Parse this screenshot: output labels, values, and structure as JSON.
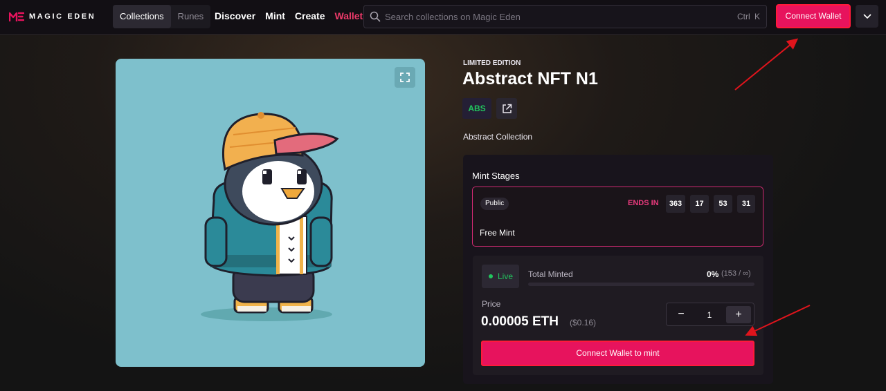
{
  "header": {
    "logo_text": "MAGIC EDEN",
    "segments": [
      "Collections",
      "Runes"
    ],
    "nav": [
      "Discover",
      "Mint",
      "Create",
      "Wallet"
    ],
    "search_placeholder": "Search collections on Magic Eden",
    "search_shortcut": "Ctrl K",
    "connect_label": "Connect Wallet",
    "colors": {
      "accent": "#e7135d",
      "wallet_link": "#f03b6b"
    }
  },
  "nft": {
    "edition": "LIMITED EDITION",
    "title": "Abstract NFT N1",
    "chain_chip": "ABS",
    "collection": "Abstract Collection",
    "art_background": "#7ec0cc"
  },
  "mint": {
    "stages_title": "Mint Stages",
    "stage_badge": "Public",
    "ends_in_label": "ENDS IN",
    "countdown": [
      "363",
      "17",
      "53",
      "31"
    ],
    "stage_name": "Free Mint",
    "live_label": "Live",
    "total_label": "Total Minted",
    "total_percent": "0%",
    "total_count": "(153 / ∞)",
    "progress_fraction": 0,
    "price_label": "Price",
    "price": "0.00005 ETH",
    "price_usd": "($0.16)",
    "quantity": "1",
    "minus": "−",
    "plus": "+",
    "mint_button": "Connect Wallet to mint"
  }
}
